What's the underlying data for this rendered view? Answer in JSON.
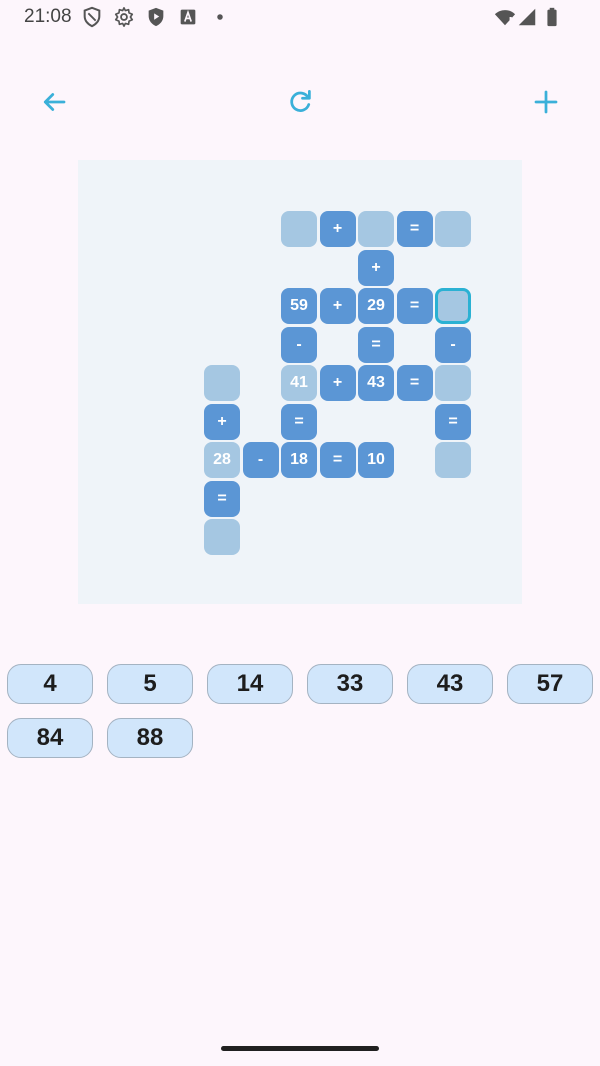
{
  "status_bar": {
    "time": "21:08",
    "left_icons": [
      "shield-icon",
      "gear-icon",
      "play-protect-icon",
      "font-a-icon",
      "dot-icon"
    ],
    "right_icons": [
      "wifi-icon",
      "signal-icon",
      "battery-icon"
    ]
  },
  "toolbar": {
    "back_icon": "arrow-left-icon",
    "refresh_icon": "refresh-icon",
    "new_icon": "plus-icon",
    "accent_color": "#3ab0d9"
  },
  "board": {
    "cells": [
      {
        "row": 0,
        "col": 4,
        "kind": "empty",
        "text": ""
      },
      {
        "row": 0,
        "col": 5,
        "kind": "op",
        "text": "+"
      },
      {
        "row": 0,
        "col": 6,
        "kind": "empty",
        "text": ""
      },
      {
        "row": 0,
        "col": 7,
        "kind": "op",
        "text": "="
      },
      {
        "row": 0,
        "col": 8,
        "kind": "empty",
        "text": ""
      },
      {
        "row": 1,
        "col": 6,
        "kind": "op",
        "text": "+"
      },
      {
        "row": 2,
        "col": 4,
        "kind": "fixed",
        "text": "59"
      },
      {
        "row": 2,
        "col": 5,
        "kind": "op",
        "text": "+"
      },
      {
        "row": 2,
        "col": 6,
        "kind": "fixed",
        "text": "29"
      },
      {
        "row": 2,
        "col": 7,
        "kind": "op",
        "text": "="
      },
      {
        "row": 2,
        "col": 8,
        "kind": "empty",
        "text": "",
        "selected": true
      },
      {
        "row": 3,
        "col": 4,
        "kind": "op",
        "text": "-"
      },
      {
        "row": 3,
        "col": 6,
        "kind": "op",
        "text": "="
      },
      {
        "row": 3,
        "col": 8,
        "kind": "op",
        "text": "-"
      },
      {
        "row": 4,
        "col": 2,
        "kind": "empty",
        "text": ""
      },
      {
        "row": 4,
        "col": 4,
        "kind": "placed",
        "text": "41"
      },
      {
        "row": 4,
        "col": 5,
        "kind": "op",
        "text": "+"
      },
      {
        "row": 4,
        "col": 6,
        "kind": "fixed",
        "text": "43"
      },
      {
        "row": 4,
        "col": 7,
        "kind": "op",
        "text": "="
      },
      {
        "row": 4,
        "col": 8,
        "kind": "empty",
        "text": ""
      },
      {
        "row": 5,
        "col": 2,
        "kind": "op",
        "text": "+"
      },
      {
        "row": 5,
        "col": 4,
        "kind": "op",
        "text": "="
      },
      {
        "row": 5,
        "col": 8,
        "kind": "op",
        "text": "="
      },
      {
        "row": 6,
        "col": 2,
        "kind": "placed",
        "text": "28"
      },
      {
        "row": 6,
        "col": 3,
        "kind": "op",
        "text": "-"
      },
      {
        "row": 6,
        "col": 4,
        "kind": "fixed",
        "text": "18"
      },
      {
        "row": 6,
        "col": 5,
        "kind": "op",
        "text": "="
      },
      {
        "row": 6,
        "col": 6,
        "kind": "fixed",
        "text": "10"
      },
      {
        "row": 6,
        "col": 8,
        "kind": "empty",
        "text": ""
      },
      {
        "row": 7,
        "col": 2,
        "kind": "op",
        "text": "="
      },
      {
        "row": 8,
        "col": 2,
        "kind": "empty",
        "text": ""
      }
    ]
  },
  "tray": {
    "tiles": [
      "4",
      "5",
      "14",
      "33",
      "43",
      "57",
      "84",
      "88"
    ]
  }
}
